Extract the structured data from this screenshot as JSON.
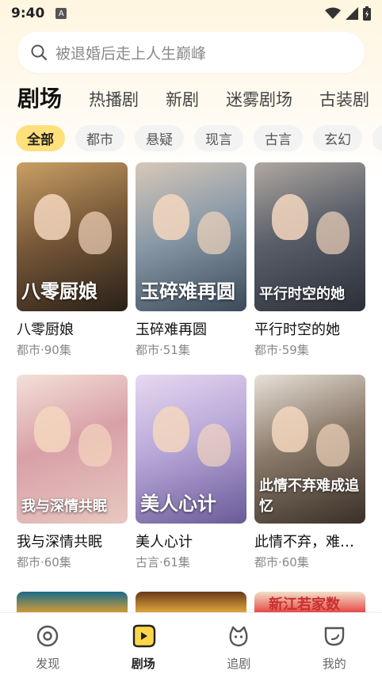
{
  "status": {
    "time": "9:40",
    "notif_letter": "A"
  },
  "search": {
    "placeholder": "被退婚后走上人生巅峰"
  },
  "main_tabs": [
    {
      "label": "剧场",
      "active": true
    },
    {
      "label": "热播剧"
    },
    {
      "label": "新剧"
    },
    {
      "label": "迷雾剧场"
    },
    {
      "label": "古装剧"
    }
  ],
  "chips": [
    {
      "label": "全部",
      "active": true
    },
    {
      "label": "都市"
    },
    {
      "label": "悬疑"
    },
    {
      "label": "现言"
    },
    {
      "label": "古言"
    },
    {
      "label": "玄幻"
    }
  ],
  "dramas": [
    {
      "name": "八零厨娘",
      "meta": "都市·90集",
      "poster_text": "八零厨娘",
      "colors": [
        "#2a2018",
        "#7a5a3a",
        "#c9a064"
      ]
    },
    {
      "name": "玉碎难再圆",
      "meta": "都市·51集",
      "poster_text": "玉碎难再圆",
      "colors": [
        "#3a4a5a",
        "#8a9aa8",
        "#d8c8b8"
      ]
    },
    {
      "name": "平行时空的她",
      "meta": "都市·59集",
      "poster_text": "平行时空的她",
      "colors": [
        "#2c2f38",
        "#5a5f6a",
        "#b0a8a0"
      ]
    },
    {
      "name": "我与深情共眠",
      "meta": "都市·60集",
      "poster_text": "我与深情共眠",
      "colors": [
        "#e8c8c0",
        "#d8a0a8",
        "#f4e0d8"
      ]
    },
    {
      "name": "美人心计",
      "meta": "古言·61集",
      "poster_text": "美人心计",
      "colors": [
        "#6a5a98",
        "#b8a8d8",
        "#e8d8f0"
      ]
    },
    {
      "name": "此情不弃，难成追忆",
      "meta": "都市·60集",
      "poster_text": "此情不弃难成追忆",
      "colors": [
        "#3a3028",
        "#8a7a6a",
        "#e8e0d8"
      ]
    }
  ],
  "partial_row": [
    {
      "colors": [
        "#1a6a8a",
        "#e0a030"
      ]
    },
    {
      "colors": [
        "#6a3818",
        "#e8b040"
      ]
    },
    {
      "colors": [
        "#f0e0c8",
        "#e84040"
      ],
      "poster_text": "新江若家数"
    }
  ],
  "bottom_nav": [
    {
      "label": "发现",
      "icon": "compass-icon"
    },
    {
      "label": "剧场",
      "icon": "play-icon",
      "active": true
    },
    {
      "label": "追剧",
      "icon": "follow-icon"
    },
    {
      "label": "我的",
      "icon": "profile-icon"
    }
  ],
  "colors": {
    "accent": "#ffd54a",
    "chip_active": "#ffe07a"
  }
}
